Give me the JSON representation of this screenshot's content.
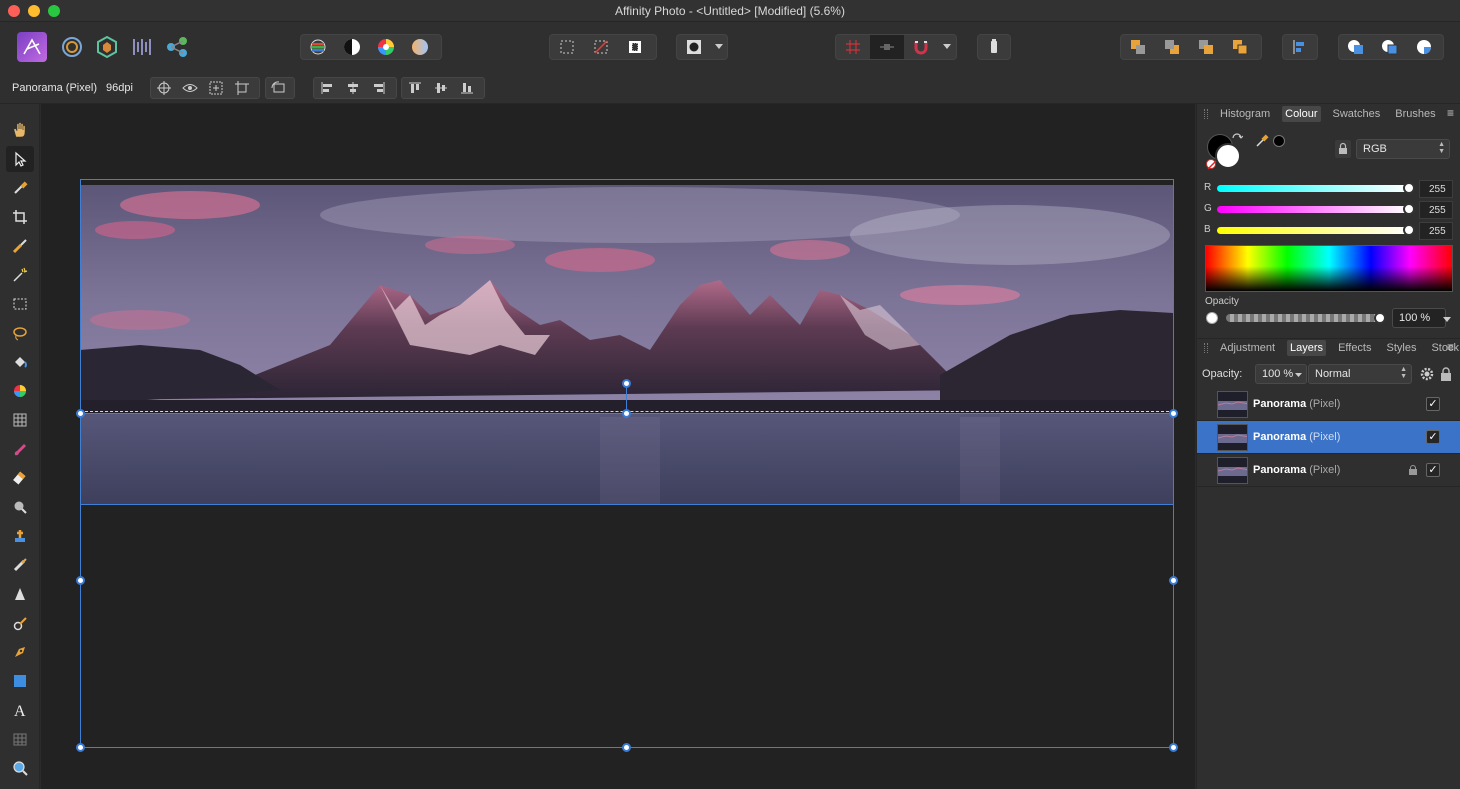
{
  "window": {
    "title": "Affinity Photo - <Untitled> [Modified] (5.6%)"
  },
  "context": {
    "layer_type": "Panorama (Pixel)",
    "dpi": "96dpi"
  },
  "colour_panel": {
    "tabs": [
      "Histogram",
      "Colour",
      "Swatches",
      "Brushes"
    ],
    "active_tab": "Colour",
    "model": "RGB",
    "channels": [
      {
        "label": "R",
        "value": "255"
      },
      {
        "label": "G",
        "value": "255"
      },
      {
        "label": "B",
        "value": "255"
      }
    ],
    "opacity_label": "Opacity",
    "opacity_value": "100 %"
  },
  "layers_panel": {
    "tabs": [
      "Adjustment",
      "Layers",
      "Effects",
      "Styles",
      "Stock"
    ],
    "active_tab": "Layers",
    "opacity_label": "Opacity:",
    "opacity_value": "100 %",
    "blend_mode": "Normal",
    "layers": [
      {
        "name": "Panorama",
        "kind": "(Pixel)",
        "visible": true,
        "locked": false,
        "selected": false
      },
      {
        "name": "Panorama",
        "kind": "(Pixel)",
        "visible": true,
        "locked": false,
        "selected": true
      },
      {
        "name": "Panorama",
        "kind": "(Pixel)",
        "visible": true,
        "locked": true,
        "selected": false
      }
    ]
  },
  "colors": {
    "accent": "#3b73c8",
    "selection": "#3f7fd6",
    "canvas": "#222222"
  },
  "icons": {
    "personas": [
      "photo-persona-icon",
      "liquify-persona-icon",
      "develop-persona-icon",
      "tone-mapping-persona-icon",
      "export-persona-icon"
    ],
    "tools": [
      "hand-tool-icon",
      "move-tool-icon",
      "colour-picker-tool-icon",
      "crop-tool-icon",
      "selection-brush-icon",
      "flood-select-icon",
      "marquee-icon",
      "freehand-select-icon",
      "flood-fill-icon",
      "gradient-icon",
      "pixel-persona-grid-icon",
      "paint-brush-icon",
      "erase-brush-icon",
      "dodge-icon",
      "clone-icon",
      "healing-icon",
      "sharpen-icon",
      "smudge-icon",
      "pen-icon",
      "rectangle-icon",
      "text-icon",
      "mesh-warp-icon",
      "zoom-icon"
    ]
  }
}
